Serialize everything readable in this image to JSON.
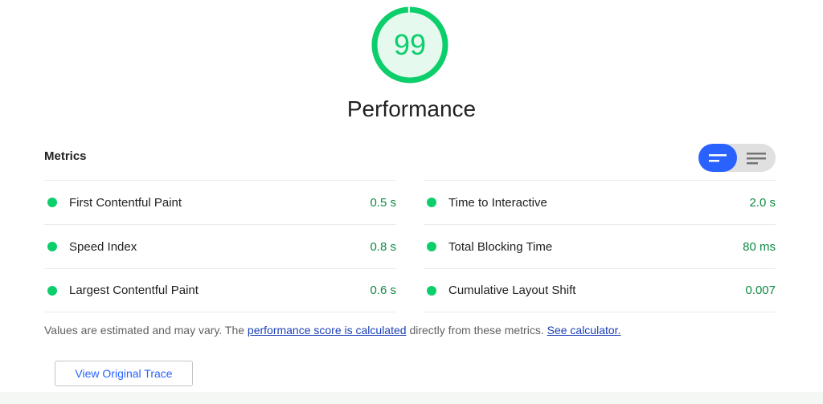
{
  "gauge": {
    "score": "99",
    "category": "Performance",
    "score_fraction": 0.99,
    "color": "#0cce6b",
    "bg_color": "#e6f9ee"
  },
  "metrics": {
    "header": "Metrics",
    "toggle": {
      "active": "grid-view",
      "icons": [
        "grid-view-icon",
        "list-view-icon"
      ]
    },
    "left": [
      {
        "title": "First Contentful Paint",
        "value": "0.5 s"
      },
      {
        "title": "Speed Index",
        "value": "0.8 s"
      },
      {
        "title": "Largest Contentful Paint",
        "value": "0.6 s"
      }
    ],
    "right": [
      {
        "title": "Time to Interactive",
        "value": "2.0 s"
      },
      {
        "title": "Total Blocking Time",
        "value": "80 ms"
      },
      {
        "title": "Cumulative Layout Shift",
        "value": "0.007"
      }
    ],
    "pass_color": "#0cce6b"
  },
  "note": {
    "text_before": "Values are estimated and may vary. The ",
    "link1": "performance score is calculated",
    "text_middle": " directly from these metrics. ",
    "link2": "See calculator."
  },
  "trace_button": {
    "label": "View Original Trace"
  }
}
